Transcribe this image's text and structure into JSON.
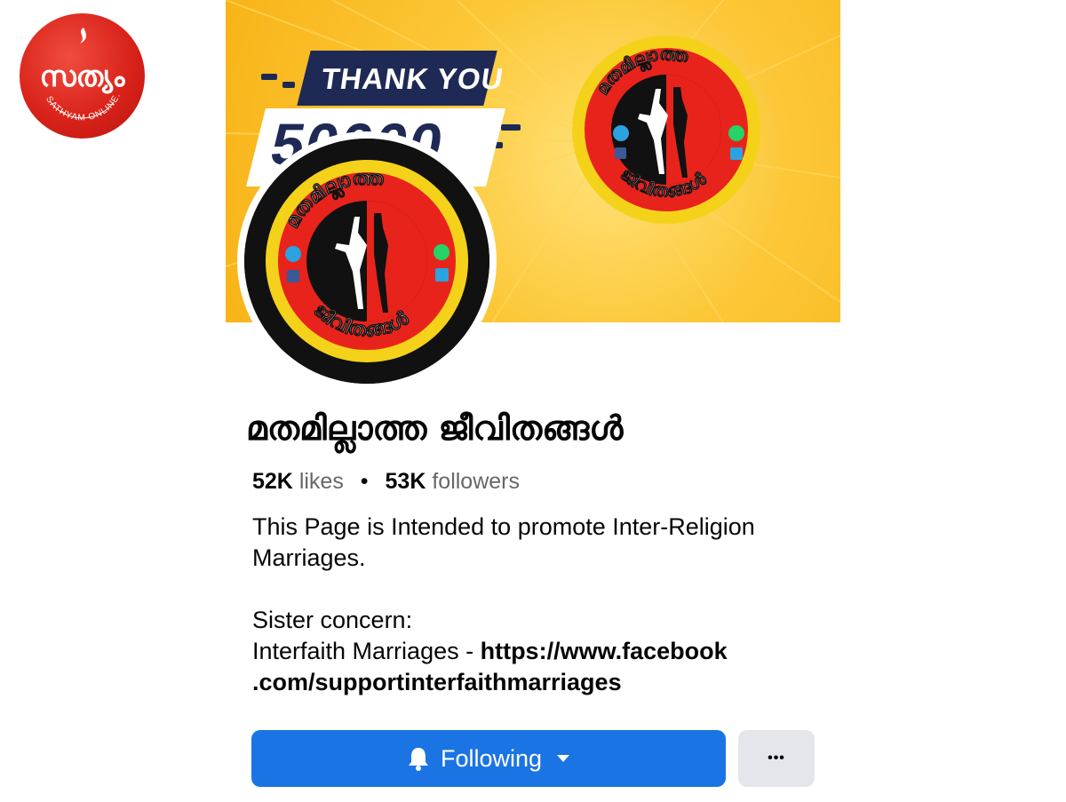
{
  "watermark": {
    "logo_text": "സത്യം",
    "site": "SATHYAM ONLINE.COM"
  },
  "cover": {
    "headline": "THANK YOU",
    "number": "50000",
    "badge_text_top": "മതമില്ലാത്ത",
    "badge_text_bottom": "ജീവിതങ്ങൾ",
    "badge_icons": [
      "telegram-icon",
      "facebook-icon",
      "whatsapp-icon",
      "hi-icon"
    ]
  },
  "profile": {
    "name": "മതമില്ലാത്ത ജീവിതങ്ങൾ",
    "likes_count": "52K",
    "likes_label": "likes",
    "separator": "•",
    "followers_count": "53K",
    "followers_label": "followers",
    "about_line1": "This Page is Intended to promote Inter-Religion Marriages.",
    "about_line2": "Sister concern:",
    "about_line3_prefix": "Interfaith Marriages - ",
    "about_link": "https://www.facebook .com/supportinterfaithmarriages"
  },
  "actions": {
    "following_label": "Following",
    "more_label": "•••"
  },
  "colors": {
    "accent": "#1b74e4",
    "secondary_button": "#e4e6eb",
    "muted_text": "#65676b",
    "cover_yellow": "#fcc737",
    "badge_red": "#e8231c",
    "badge_yellow": "#f5d21a"
  }
}
